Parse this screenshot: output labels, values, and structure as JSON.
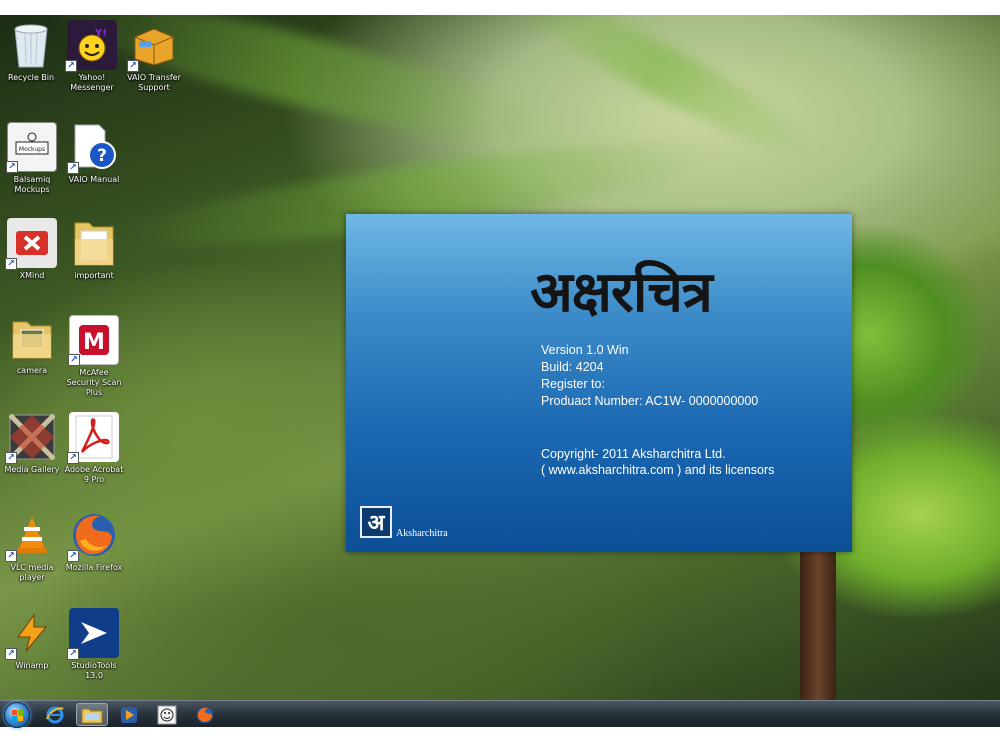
{
  "desktop": {
    "icons": [
      {
        "label": "Recycle Bin",
        "icon": "recycle-bin-icon",
        "shortcut": false
      },
      {
        "label": "Yahoo! Messenger",
        "icon": "yahoo-messenger-icon",
        "shortcut": true
      },
      {
        "label": "VAIO Transfer Support",
        "icon": "box-icon",
        "shortcut": true
      },
      {
        "label": "Balsamiq Mockups",
        "icon": "balsamiq-icon",
        "shortcut": true
      },
      {
        "label": "VAIO Manual",
        "icon": "help-document-icon",
        "shortcut": true
      },
      {
        "label": "XMind",
        "icon": "xmind-icon",
        "shortcut": true
      },
      {
        "label": "important",
        "icon": "folder-icon",
        "shortcut": false
      },
      {
        "label": "camera",
        "icon": "folder-photos-icon",
        "shortcut": false
      },
      {
        "label": "McAfee Security Scan Plus",
        "icon": "mcafee-icon",
        "shortcut": true
      },
      {
        "label": "Media Gallery",
        "icon": "media-gallery-icon",
        "shortcut": true
      },
      {
        "label": "Adobe Acrobat 9 Pro",
        "icon": "acrobat-icon",
        "shortcut": true
      },
      {
        "label": "VLC media player",
        "icon": "vlc-icon",
        "shortcut": true
      },
      {
        "label": "Mozilla Firefox",
        "icon": "firefox-icon",
        "shortcut": true
      },
      {
        "label": "Winamp",
        "icon": "winamp-icon",
        "shortcut": true
      },
      {
        "label": "StudioTools 13.0",
        "icon": "studiotools-icon",
        "shortcut": true
      }
    ]
  },
  "splash": {
    "title": "अक्षरचित्र",
    "version": "Version 1.0 Win",
    "build": "Build: 4204",
    "register": "Register to:",
    "product_number": "Produact Number: AC1W- 0000000000",
    "copyright": "Copyright- 2011 Aksharchitra Ltd.",
    "website": "( www.aksharchitra.com ) and its licensors",
    "logo_glyph": "अ",
    "brand": "Aksharchitra"
  },
  "taskbar": {
    "items": [
      {
        "icon": "start-orb-icon"
      },
      {
        "icon": "internet-explorer-icon"
      },
      {
        "icon": "windows-explorer-icon"
      },
      {
        "icon": "media-player-icon"
      },
      {
        "icon": "balsamiq-icon"
      },
      {
        "icon": "firefox-icon"
      }
    ]
  },
  "colors": {
    "splash_top": "#6fb8e6",
    "splash_bottom": "#0c4f96",
    "taskbar": "#28323b"
  }
}
